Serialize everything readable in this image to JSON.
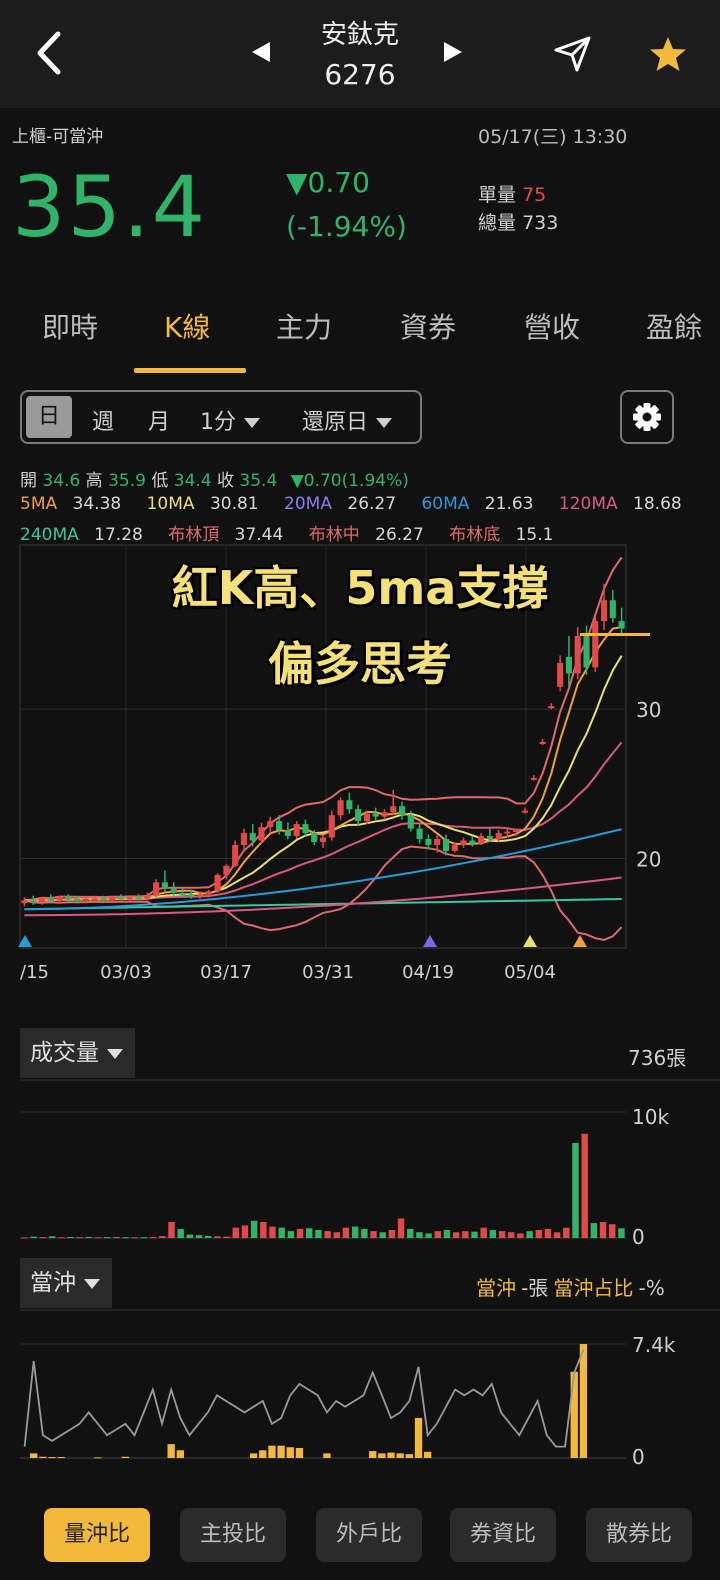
{
  "header": {
    "stock_name": "安鈦克",
    "stock_code": "6276"
  },
  "quote": {
    "market_tag": "上櫃-可當沖",
    "datetime": "05/17(三) 13:30",
    "price": "35.4",
    "change": "▼0.70",
    "change_pct": "(-1.94%)",
    "single_vol_label": "單量",
    "single_vol": "75",
    "total_vol_label": "總量",
    "total_vol": "733"
  },
  "tabs": [
    "即時",
    "K線",
    "主力",
    "資券",
    "營收",
    "盈餘"
  ],
  "active_tab": "K線",
  "periods": {
    "day": "日",
    "week": "週",
    "month": "月",
    "minute": "1分",
    "adjust": "還原日"
  },
  "ohlc": {
    "open_label": "開",
    "open": "34.6",
    "high_label": "高",
    "high": "35.9",
    "low_label": "低",
    "low": "34.4",
    "close_label": "收",
    "close": "35.4",
    "change": "▼0.70(1.94%)"
  },
  "ma": {
    "ma5_label": "5MA",
    "ma5": "34.38",
    "ma10_label": "10MA",
    "ma10": "30.81",
    "ma20_label": "20MA",
    "ma20": "26.27",
    "ma60_label": "60MA",
    "ma60": "21.63",
    "ma120_label": "120MA",
    "ma120": "18.68",
    "ma240_label": "240MA",
    "ma240": "17.28",
    "boll_top_label": "布林頂",
    "boll_top": "37.44",
    "boll_mid_label": "布林中",
    "boll_mid": "26.27",
    "boll_bot_label": "布林底",
    "boll_bot": "15.1"
  },
  "colors": {
    "up": "#e24a4a",
    "down": "#2fb46a",
    "accent": "#f2b93b",
    "ma5": "#f0a040",
    "ma10": "#e8e070",
    "ma20": "#6a6ae8",
    "ma60": "#2a9ad8",
    "ma120": "#d85a8a",
    "ma240": "#3ac8a0",
    "boll": "#e06a6a"
  },
  "annotation": {
    "line1": "紅K高、5ma支撐",
    "line2": "偏多思考"
  },
  "chart_data": [
    {
      "type": "candlestick",
      "x_ticks": [
        "/15",
        "03/03",
        "03/17",
        "03/31",
        "04/19",
        "05/04"
      ],
      "y_ticks": [
        "30",
        "20"
      ],
      "ylim": [
        14,
        41
      ],
      "candles": [
        {
          "o": 17.0,
          "h": 17.4,
          "l": 16.8,
          "c": 17.2
        },
        {
          "o": 17.2,
          "h": 17.5,
          "l": 16.9,
          "c": 17.1
        },
        {
          "o": 17.1,
          "h": 17.4,
          "l": 16.9,
          "c": 17.3
        },
        {
          "o": 17.3,
          "h": 17.6,
          "l": 17.0,
          "c": 17.2
        },
        {
          "o": 17.2,
          "h": 17.5,
          "l": 17.0,
          "c": 17.4
        },
        {
          "o": 17.4,
          "h": 17.6,
          "l": 17.1,
          "c": 17.3
        },
        {
          "o": 17.3,
          "h": 17.5,
          "l": 17.0,
          "c": 17.2
        },
        {
          "o": 17.2,
          "h": 17.4,
          "l": 17.0,
          "c": 17.3
        },
        {
          "o": 17.3,
          "h": 17.5,
          "l": 17.1,
          "c": 17.3
        },
        {
          "o": 17.3,
          "h": 17.5,
          "l": 17.1,
          "c": 17.2
        },
        {
          "o": 17.2,
          "h": 17.5,
          "l": 17.0,
          "c": 17.4
        },
        {
          "o": 17.4,
          "h": 17.6,
          "l": 17.2,
          "c": 17.3
        },
        {
          "o": 17.3,
          "h": 17.5,
          "l": 17.1,
          "c": 17.4
        },
        {
          "o": 17.4,
          "h": 17.6,
          "l": 17.2,
          "c": 17.3
        },
        {
          "o": 17.3,
          "h": 17.7,
          "l": 17.2,
          "c": 17.5
        },
        {
          "o": 17.5,
          "h": 18.6,
          "l": 17.4,
          "c": 18.4
        },
        {
          "o": 18.4,
          "h": 19.2,
          "l": 17.8,
          "c": 18.0
        },
        {
          "o": 18.0,
          "h": 18.4,
          "l": 17.5,
          "c": 17.7
        },
        {
          "o": 17.7,
          "h": 18.0,
          "l": 17.4,
          "c": 17.6
        },
        {
          "o": 17.6,
          "h": 17.9,
          "l": 17.3,
          "c": 17.5
        },
        {
          "o": 17.5,
          "h": 17.8,
          "l": 17.3,
          "c": 17.6
        },
        {
          "o": 17.6,
          "h": 17.9,
          "l": 17.4,
          "c": 17.8
        },
        {
          "o": 17.8,
          "h": 19.0,
          "l": 17.7,
          "c": 18.9
        },
        {
          "o": 18.9,
          "h": 19.6,
          "l": 18.6,
          "c": 19.5
        },
        {
          "o": 19.5,
          "h": 21.2,
          "l": 19.4,
          "c": 20.9
        },
        {
          "o": 20.9,
          "h": 22.0,
          "l": 20.5,
          "c": 21.7
        },
        {
          "o": 21.7,
          "h": 22.3,
          "l": 20.8,
          "c": 21.2
        },
        {
          "o": 21.2,
          "h": 22.4,
          "l": 21.0,
          "c": 22.1
        },
        {
          "o": 22.1,
          "h": 22.8,
          "l": 21.7,
          "c": 22.5
        },
        {
          "o": 22.5,
          "h": 22.9,
          "l": 21.6,
          "c": 21.9
        },
        {
          "o": 21.9,
          "h": 22.4,
          "l": 21.3,
          "c": 21.5
        },
        {
          "o": 21.5,
          "h": 22.5,
          "l": 21.3,
          "c": 22.3
        },
        {
          "o": 22.3,
          "h": 22.6,
          "l": 21.5,
          "c": 21.7
        },
        {
          "o": 21.7,
          "h": 21.9,
          "l": 20.9,
          "c": 21.1
        },
        {
          "o": 21.1,
          "h": 21.6,
          "l": 20.7,
          "c": 21.4
        },
        {
          "o": 21.4,
          "h": 23.2,
          "l": 21.2,
          "c": 22.9
        },
        {
          "o": 22.9,
          "h": 24.1,
          "l": 22.6,
          "c": 23.9
        },
        {
          "o": 23.9,
          "h": 24.4,
          "l": 23.0,
          "c": 23.3
        },
        {
          "o": 23.3,
          "h": 23.6,
          "l": 22.2,
          "c": 22.5
        },
        {
          "o": 22.5,
          "h": 23.2,
          "l": 22.3,
          "c": 23.0
        },
        {
          "o": 23.0,
          "h": 23.4,
          "l": 22.5,
          "c": 22.8
        },
        {
          "o": 22.8,
          "h": 23.3,
          "l": 22.6,
          "c": 23.1
        },
        {
          "o": 23.1,
          "h": 24.6,
          "l": 22.9,
          "c": 23.5
        },
        {
          "o": 23.5,
          "h": 23.8,
          "l": 22.6,
          "c": 22.9
        },
        {
          "o": 22.9,
          "h": 23.2,
          "l": 21.8,
          "c": 22.0
        },
        {
          "o": 22.0,
          "h": 22.3,
          "l": 21.0,
          "c": 21.3
        },
        {
          "o": 21.3,
          "h": 21.6,
          "l": 20.6,
          "c": 20.9
        },
        {
          "o": 20.9,
          "h": 21.6,
          "l": 20.4,
          "c": 21.3
        },
        {
          "o": 21.3,
          "h": 21.6,
          "l": 20.2,
          "c": 20.5
        },
        {
          "o": 20.5,
          "h": 21.1,
          "l": 20.4,
          "c": 20.9
        },
        {
          "o": 20.9,
          "h": 21.4,
          "l": 20.7,
          "c": 21.2
        },
        {
          "o": 21.2,
          "h": 21.5,
          "l": 20.8,
          "c": 21.0
        },
        {
          "o": 21.0,
          "h": 21.7,
          "l": 20.9,
          "c": 21.5
        },
        {
          "o": 21.5,
          "h": 22.0,
          "l": 21.1,
          "c": 21.3
        },
        {
          "o": 21.3,
          "h": 21.9,
          "l": 21.1,
          "c": 21.7
        },
        {
          "o": 21.7,
          "h": 22.0,
          "l": 21.4,
          "c": 21.8
        },
        {
          "o": 21.8,
          "h": 22.0,
          "l": 21.5,
          "c": 21.9
        },
        {
          "o": 23.2,
          "h": 23.4,
          "l": 23.0,
          "c": 23.2
        },
        {
          "o": 25.4,
          "h": 25.6,
          "l": 25.2,
          "c": 25.4
        },
        {
          "o": 27.8,
          "h": 28.0,
          "l": 27.6,
          "c": 27.8
        },
        {
          "o": 30.2,
          "h": 30.4,
          "l": 30.0,
          "c": 30.2
        },
        {
          "o": 31.5,
          "h": 33.6,
          "l": 31.2,
          "c": 33.1
        },
        {
          "o": 33.5,
          "h": 34.9,
          "l": 31.5,
          "c": 32.4
        },
        {
          "o": 32.4,
          "h": 35.5,
          "l": 32.0,
          "c": 34.9
        },
        {
          "o": 34.9,
          "h": 35.6,
          "l": 32.3,
          "c": 32.8
        },
        {
          "o": 32.8,
          "h": 36.2,
          "l": 32.5,
          "c": 35.9
        },
        {
          "o": 35.9,
          "h": 38.4,
          "l": 35.3,
          "c": 37.3
        },
        {
          "o": 37.3,
          "h": 38.0,
          "l": 35.8,
          "c": 36.1
        },
        {
          "o": 35.9,
          "h": 36.8,
          "l": 35.0,
          "c": 35.4
        }
      ],
      "support_line": 35.0
    },
    {
      "type": "bar",
      "title": "成交量",
      "summary": "736張",
      "y_ticks": [
        "10k",
        "0"
      ],
      "ylim": [
        0,
        11000
      ],
      "values": [
        60,
        120,
        80,
        150,
        60,
        90,
        70,
        100,
        60,
        80,
        90,
        70,
        60,
        70,
        80,
        160,
        1400,
        800,
        300,
        250,
        180,
        150,
        120,
        900,
        1100,
        1500,
        1400,
        1000,
        900,
        600,
        800,
        850,
        700,
        600,
        500,
        900,
        1000,
        800,
        600,
        500,
        700,
        1700,
        800,
        500,
        400,
        600,
        700,
        500,
        600,
        550,
        900,
        700,
        600,
        500,
        400,
        600,
        700,
        800,
        500,
        900,
        8300,
        9100,
        1300,
        1400,
        1200,
        850
      ],
      "up": [
        1,
        0,
        1,
        0,
        1,
        0,
        1,
        0,
        1,
        0,
        1,
        0,
        1,
        0,
        1,
        1,
        1,
        0,
        0,
        0,
        0,
        1,
        1,
        1,
        1,
        0,
        1,
        1,
        0,
        0,
        1,
        0,
        0,
        1,
        1,
        1,
        0,
        0,
        1,
        0,
        1,
        1,
        0,
        0,
        0,
        1,
        0,
        1,
        1,
        0,
        1,
        0,
        1,
        1,
        1,
        0,
        1,
        1,
        1,
        1,
        0,
        1,
        0,
        1,
        1,
        0
      ]
    },
    {
      "type": "bar",
      "title": "當沖",
      "summary_label_1": "當沖",
      "summary_value_1": "-張",
      "summary_label_2": "當沖占比",
      "summary_value_2": "-%",
      "y_ticks": [
        "7.4k",
        "0"
      ],
      "ylim": [
        0,
        7400
      ],
      "values": [
        0,
        300,
        80,
        60,
        60,
        0,
        0,
        0,
        40,
        0,
        0,
        80,
        0,
        0,
        0,
        0,
        900,
        500,
        0,
        0,
        0,
        0,
        0,
        0,
        0,
        300,
        500,
        800,
        800,
        700,
        650,
        0,
        0,
        300,
        0,
        0,
        0,
        0,
        450,
        300,
        350,
        300,
        250,
        2600,
        400,
        0,
        0,
        0,
        0,
        0,
        0,
        0,
        0,
        0,
        0,
        0,
        0,
        0,
        0,
        0,
        5600,
        7400
      ]
    }
  ],
  "bottom_buttons": [
    "量沖比",
    "主投比",
    "外戶比",
    "券資比",
    "散券比"
  ]
}
